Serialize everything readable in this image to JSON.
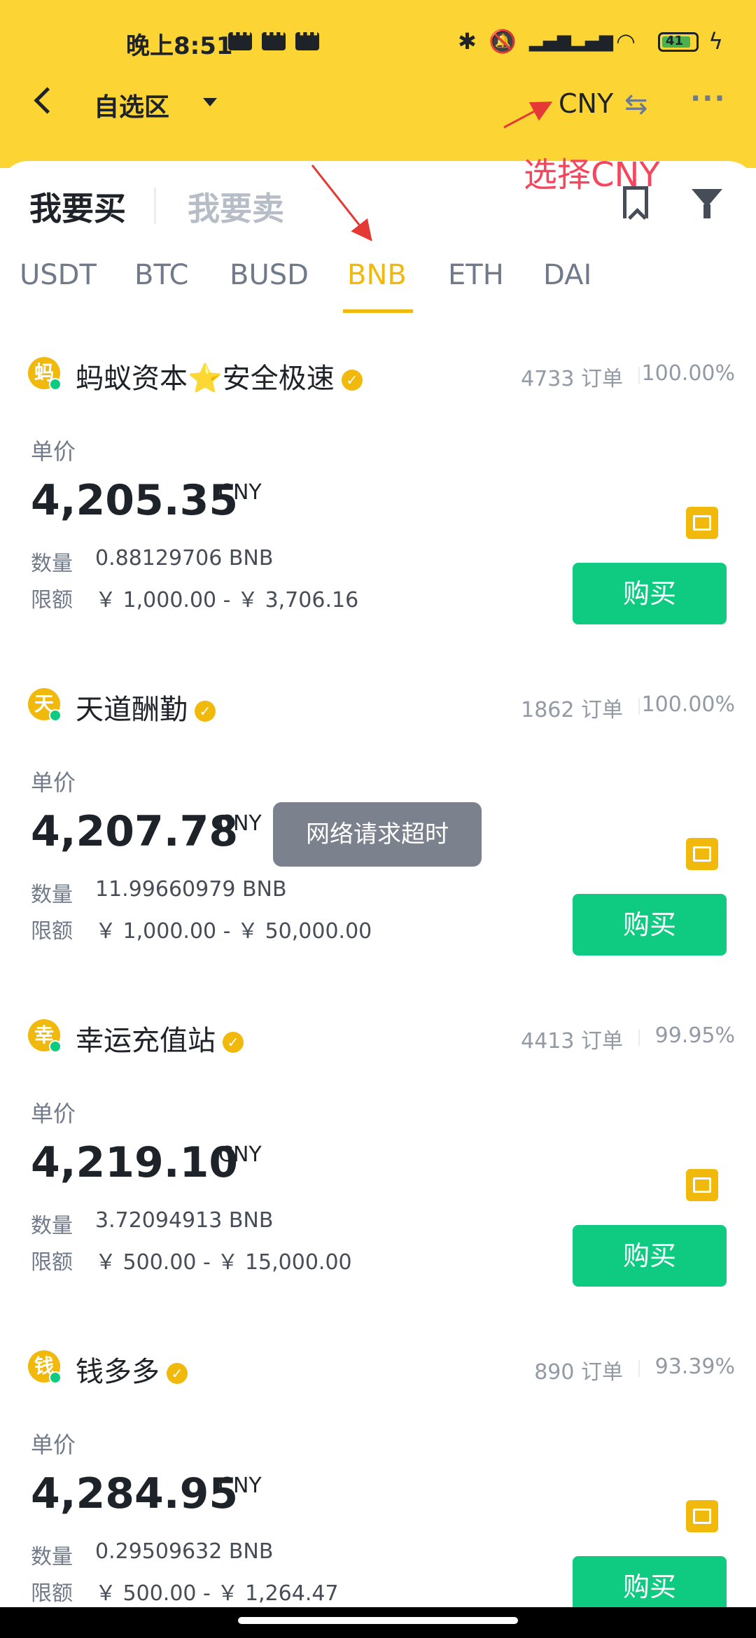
{
  "status_bar": {
    "time": "晚上8:51",
    "battery": "41"
  },
  "nav": {
    "back_icon": "chevron-left-icon",
    "title": "自选区",
    "currency": "CNY"
  },
  "annotation": {
    "text": "选择CNY",
    "color": "#f6465d"
  },
  "trade_tabs": {
    "buy": "我要买",
    "sell": "我要卖"
  },
  "coins": [
    "USDT",
    "BTC",
    "BUSD",
    "BNB",
    "ETH",
    "DAI"
  ],
  "active_coin": "BNB",
  "colors": {
    "brand": "#fcd535",
    "accent": "#f0b90b",
    "buy": "#0ecb81"
  },
  "labels": {
    "price": "单价",
    "quantity": "数量",
    "limit": "限额",
    "buy_button": "购买"
  },
  "ads": [
    {
      "avatar": "蚂",
      "name": "蚂蚁资本⭐安全极速",
      "orders": "4733 订单",
      "completion": "100.00%",
      "price": "4,205.35",
      "unit": "CNY",
      "quantity": "0.88129706 BNB",
      "limit": "￥ 1,000.00 - ￥ 3,706.16"
    },
    {
      "avatar": "天",
      "name": "天道酬勤",
      "orders": "1862 订单",
      "completion": "100.00%",
      "price": "4,207.78",
      "unit": "CNY",
      "quantity": "11.99660979 BNB",
      "limit": "￥ 1,000.00 - ￥ 50,000.00"
    },
    {
      "avatar": "幸",
      "name": "幸运充值站",
      "orders": "4413 订单",
      "completion": "99.95%",
      "price": "4,219.10",
      "unit": "CNY",
      "quantity": "3.72094913 BNB",
      "limit": "￥ 500.00 - ￥ 15,000.00"
    },
    {
      "avatar": "钱",
      "name": "钱多多",
      "orders": "890 订单",
      "completion": "93.39%",
      "price": "4,284.95",
      "unit": "CNY",
      "quantity": "0.29509632 BNB",
      "limit": "￥ 500.00 - ￥ 1,264.47"
    }
  ],
  "toast": "网络请求超时"
}
